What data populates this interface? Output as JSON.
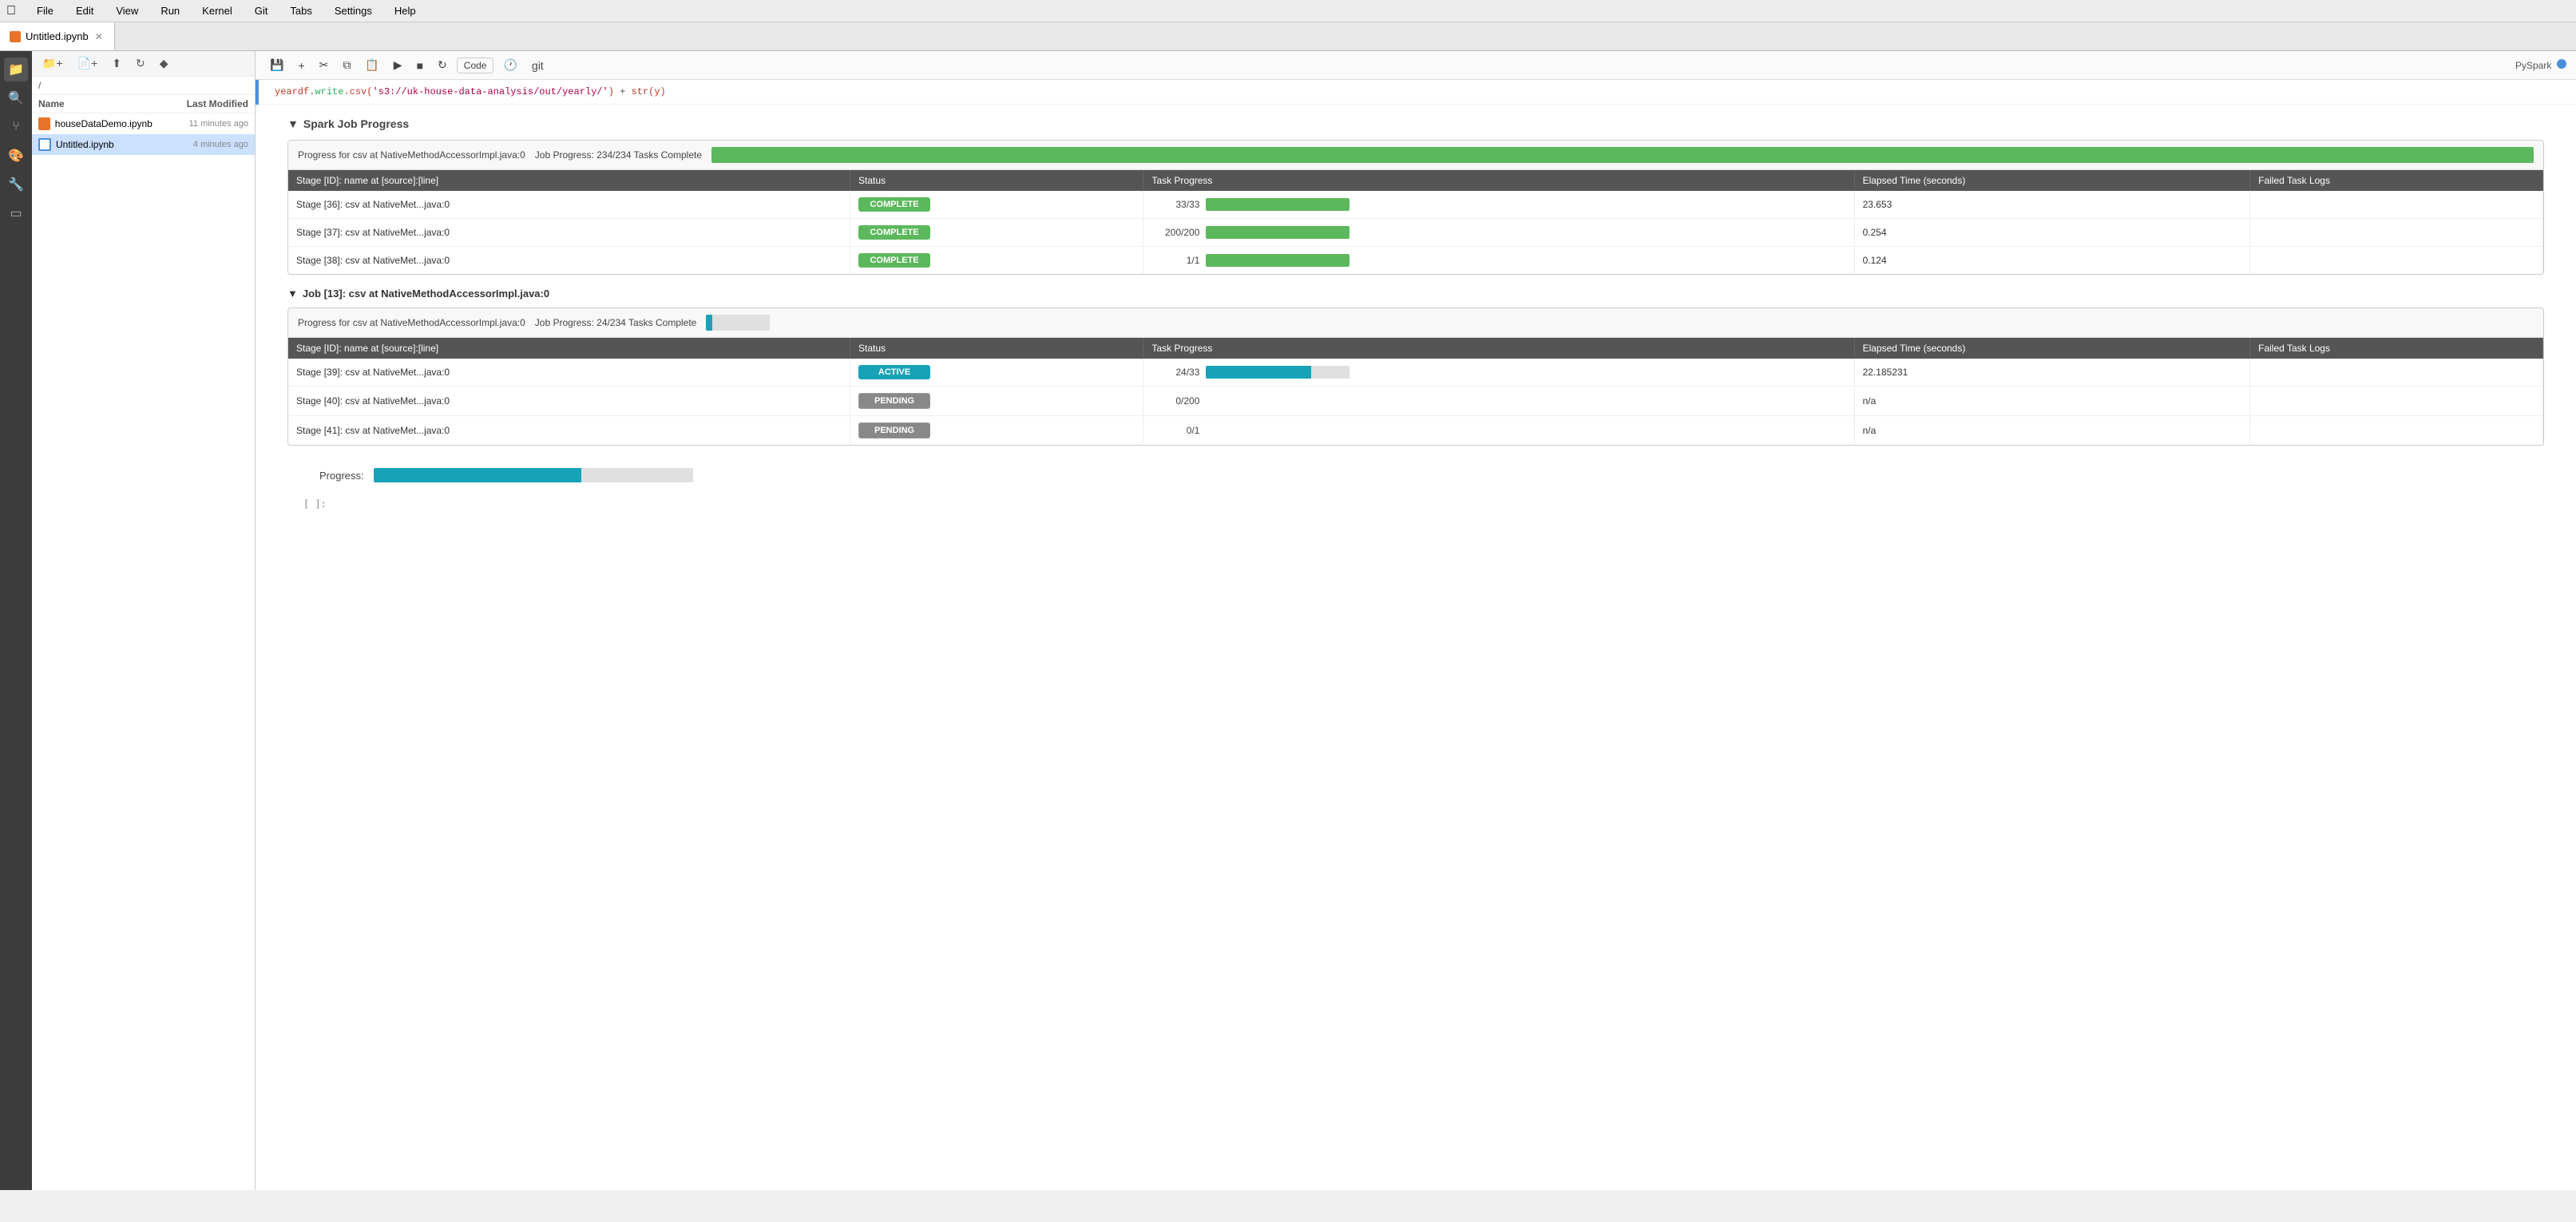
{
  "menubar": {
    "items": [
      "File",
      "Edit",
      "View",
      "Run",
      "Kernel",
      "Git",
      "Tabs",
      "Settings",
      "Help"
    ]
  },
  "toolbar": {
    "new_folder": "📁",
    "upload": "⬆",
    "refresh": "↻",
    "git": "◆"
  },
  "tab": {
    "name": "Untitled.ipynb",
    "icon": "orange"
  },
  "notebook_toolbar": {
    "save": "💾",
    "add": "+",
    "cut": "✂",
    "copy": "⧉",
    "paste": "📋",
    "run": "▶",
    "stop": "■",
    "restart": "↻",
    "code_label": "Code",
    "clock_icon": "🕐",
    "git_label": "git",
    "spark_label": "PySpark",
    "kernel_indicator": "●"
  },
  "sidebar": {
    "path": "/",
    "files": [
      {
        "name": "houseDataDemo.ipynb",
        "modified": "11 minutes ago",
        "type": "orange"
      },
      {
        "name": "Untitled.ipynb",
        "modified": "4 minutes ago",
        "type": "blue"
      }
    ],
    "col_name": "Name",
    "col_date": "Last Modified"
  },
  "code_line": "yeardf.write.csv('s3://uk-house-data-analysis/out/yearly/') + str(y)",
  "spark_job_progress": {
    "title": "Spark Job Progress",
    "jobs": [
      {
        "progress_label": "Progress for csv at NativeMethodAccessorImpl.java:0",
        "job_progress_label": "Job Progress: 234/234 Tasks Complete",
        "progress_pct": 100,
        "progress_color": "green",
        "stages": [
          {
            "id": "Stage [36]: csv at NativeMet...java:0",
            "status": "COMPLETE",
            "task_done": 33,
            "task_total": 33,
            "task_pct": 100,
            "bar_color": "green",
            "elapsed": "23.653",
            "failed": ""
          },
          {
            "id": "Stage [37]: csv at NativeMet...java:0",
            "status": "COMPLETE",
            "task_done": 200,
            "task_total": 200,
            "task_pct": 100,
            "bar_color": "green",
            "elapsed": "0.254",
            "failed": ""
          },
          {
            "id": "Stage [38]: csv at NativeMet...java:0",
            "status": "COMPLETE",
            "task_done": 1,
            "task_total": 1,
            "task_pct": 100,
            "bar_color": "green",
            "elapsed": "0.124",
            "failed": ""
          }
        ]
      }
    ],
    "job13": {
      "title": "Job [13]: csv at NativeMethodAccessorImpl.java:0",
      "progress_label": "Progress for csv at NativeMethodAccessorImpl.java:0",
      "job_progress_label": "Job Progress: 24/234 Tasks Complete",
      "progress_pct": 10,
      "progress_color": "cyan",
      "stages": [
        {
          "id": "Stage [39]: csv at NativeMet...java:0",
          "status": "ACTIVE",
          "task_done": 24,
          "task_total": 33,
          "task_pct": 73,
          "bar_color": "cyan",
          "elapsed": "22.185231",
          "failed": ""
        },
        {
          "id": "Stage [40]: csv at NativeMet...java:0",
          "status": "PENDING",
          "task_done": 0,
          "task_total": 200,
          "task_pct": 0,
          "bar_color": "green",
          "elapsed": "n/a",
          "failed": ""
        },
        {
          "id": "Stage [41]: csv at NativeMet...java:0",
          "status": "PENDING",
          "task_done": 0,
          "task_total": 1,
          "task_pct": 0,
          "bar_color": "green",
          "elapsed": "n/a",
          "failed": ""
        }
      ]
    },
    "table_headers": [
      "Stage [ID]: name at [source]:[line]",
      "Status",
      "Task Progress",
      "Elapsed Time (seconds)",
      "Failed Task Logs"
    ]
  },
  "bottom_progress": {
    "label": "Progress:",
    "pct": 65
  },
  "empty_cell": "[ ]:"
}
